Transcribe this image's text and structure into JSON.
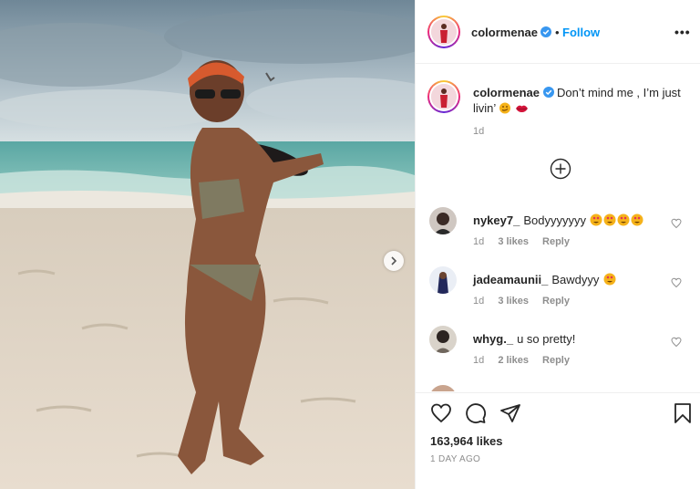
{
  "post": {
    "image_alt": "Woman in a bikini posing on a sandy beach",
    "account": {
      "username": "colormenae",
      "separator": "•",
      "follow_label": "Follow",
      "more_label": "•••"
    },
    "caption": {
      "username": "colormenae",
      "text": "Don’t mind me , I’m just livin’",
      "time": "1d"
    },
    "comments": [
      {
        "username": "nykey7_",
        "text": "Bodyyyyyyy",
        "emojis": 4,
        "time": "1d",
        "likes": "3 likes",
        "reply": "Reply"
      },
      {
        "username": "jadeamaunii_",
        "text": "Bawdyyy",
        "emojis": 1,
        "time": "1d",
        "likes": "3 likes",
        "reply": "Reply"
      },
      {
        "username": "whyg._",
        "text": "u so pretty!",
        "emojis": 0,
        "time": "1d",
        "likes": "2 likes",
        "reply": "Reply"
      }
    ],
    "likes_total": "163,964 likes",
    "date": "1 DAY AGO"
  },
  "colors": {
    "accent": "#0095f6",
    "verified": "#3897f0",
    "secondary_text": "#8e8e8e",
    "border": "#efefef"
  },
  "icons": [
    "verified-badge-icon",
    "more-options-icon",
    "load-more-plus-icon",
    "heart-icon",
    "comment-icon",
    "share-icon",
    "bookmark-icon",
    "chevron-right-icon"
  ]
}
